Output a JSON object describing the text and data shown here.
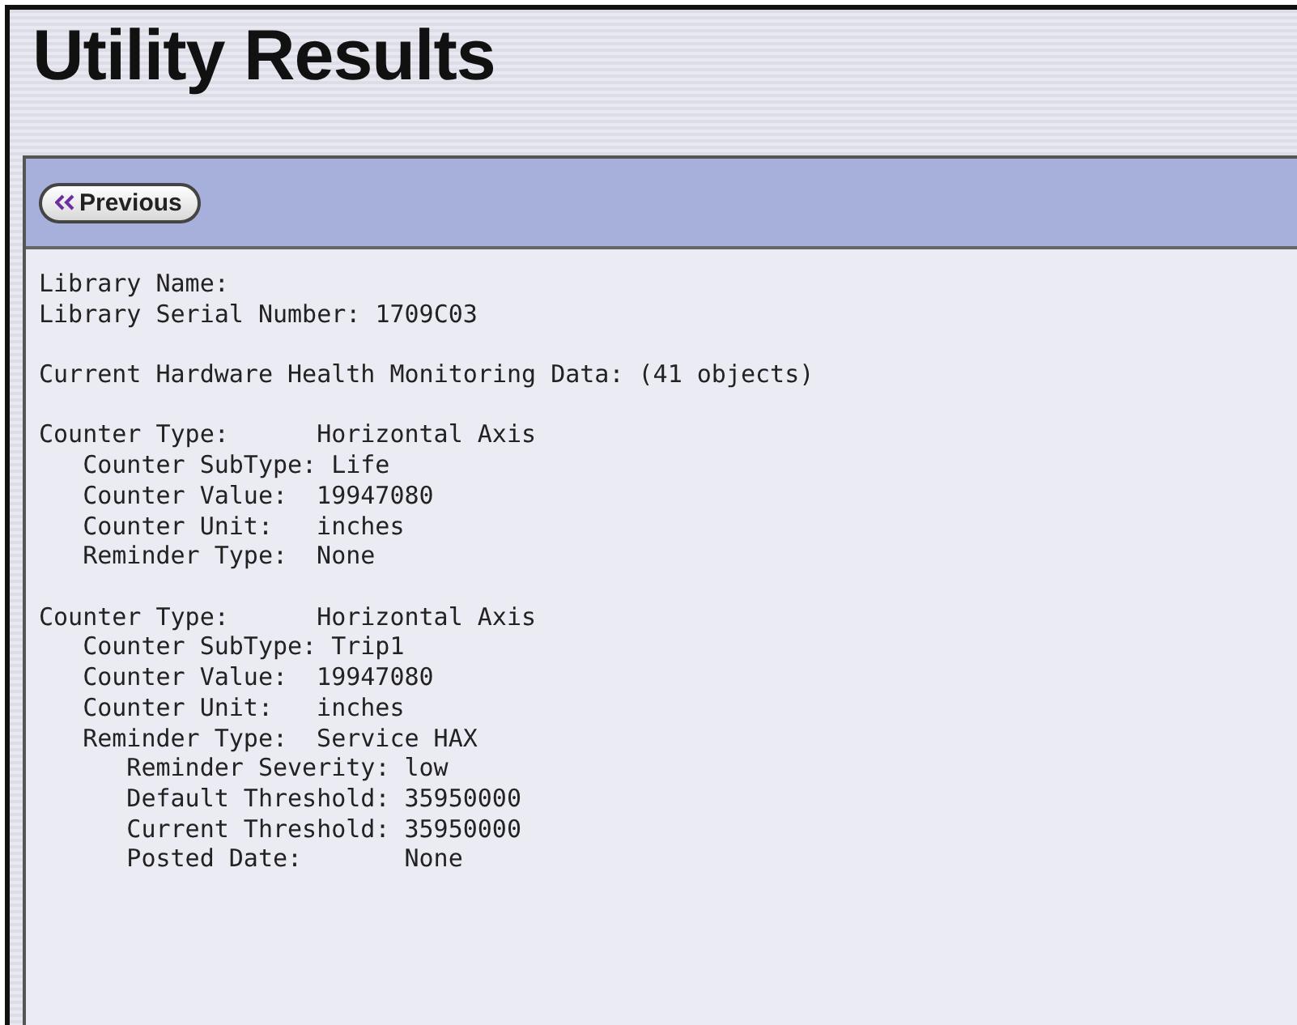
{
  "page": {
    "title": "Utility Results"
  },
  "toolbar": {
    "previous_button": "Previous"
  },
  "report": {
    "library_lines": [
      "Library Name:",
      "Library Serial Number: 1709C03"
    ],
    "summary": "Current Hardware Health Monitoring Data: (41 objects)",
    "counters": [
      {
        "label": "Counter Type:",
        "value": "Horizontal Axis",
        "children": [
          {
            "label": "Counter SubType:",
            "value": "Life"
          },
          {
            "label": "Counter Value:",
            "value": "19947080"
          },
          {
            "label": "Counter Unit:",
            "value": "inches"
          },
          {
            "label": "Reminder Type:",
            "value": "None"
          }
        ]
      },
      {
        "label": "Counter Type:",
        "value": "Horizontal Axis",
        "children": [
          {
            "label": "Counter SubType:",
            "value": "Trip1"
          },
          {
            "label": "Counter Value:",
            "value": "19947080"
          },
          {
            "label": "Counter Unit:",
            "value": "inches"
          },
          {
            "label": "Reminder Type:",
            "value": "Service HAX",
            "children": [
              {
                "label": "Reminder Severity:",
                "value": "low"
              },
              {
                "label": "Default Threshold:",
                "value": "35950000"
              },
              {
                "label": "Current Threshold:",
                "value": "35950000"
              },
              {
                "label": "Posted Date:",
                "value": "None"
              }
            ]
          }
        ]
      }
    ]
  }
}
